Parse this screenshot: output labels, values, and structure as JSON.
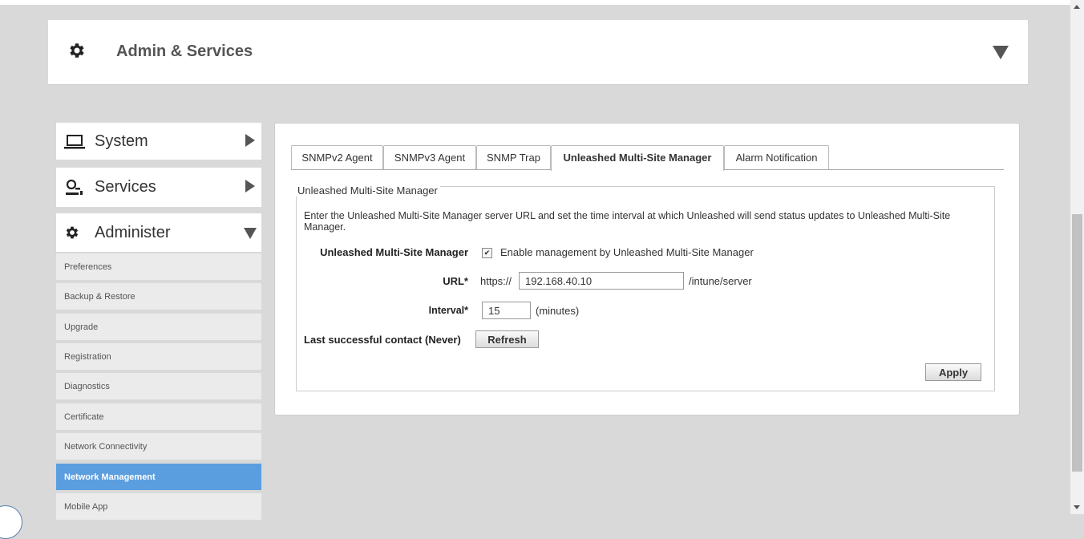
{
  "header": {
    "title": "Admin & Services"
  },
  "nav": {
    "sections": [
      {
        "label": "System"
      },
      {
        "label": "Services"
      },
      {
        "label": "Administer"
      }
    ],
    "items": [
      "Preferences",
      "Backup & Restore",
      "Upgrade",
      "Registration",
      "Diagnostics",
      "Certificate",
      "Network Connectivity",
      "Network Management",
      "Mobile App"
    ],
    "active_item": "Network Management"
  },
  "tabs": [
    "SNMPv2 Agent",
    "SNMPv3 Agent",
    "SNMP Trap",
    "Unleashed Multi-Site Manager",
    "Alarm Notification"
  ],
  "active_tab": "Unleashed Multi-Site Manager",
  "form": {
    "legend": "Unleashed Multi-Site Manager",
    "description": "Enter the Unleashed Multi-Site Manager server URL and set the time interval at which Unleashed will send status updates to Unleashed Multi-Site Manager.",
    "manager_label": "Unleashed Multi-Site Manager",
    "enable_checked": true,
    "enable_mark": "✔",
    "enable_text": "Enable management by Unleashed Multi-Site Manager",
    "url_label": "URL*",
    "url_prefix": "https://",
    "url_value": "192.168.40.10",
    "url_suffix": "/intune/server",
    "interval_label": "Interval*",
    "interval_value": "15",
    "interval_unit": "(minutes)",
    "last_contact_label": "Last successful contact (Never)",
    "refresh_label": "Refresh",
    "apply_label": "Apply"
  },
  "colors": {
    "active_nav": "#5b9ee0",
    "background": "#d9d9d9"
  }
}
